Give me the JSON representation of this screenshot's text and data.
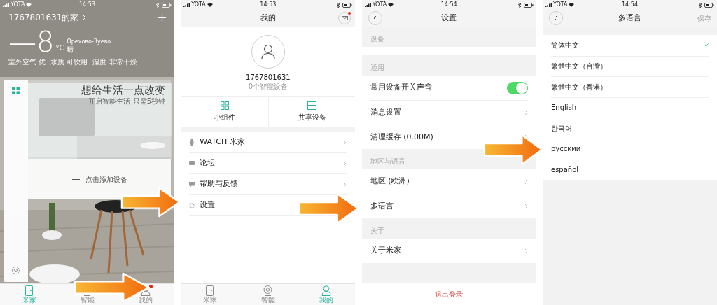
{
  "home_screen": {
    "status_bar": {
      "carrier": "YOTA",
      "time": "14:53"
    },
    "home_name": "1767801631的家",
    "temperature": "—8",
    "unit": "°C",
    "city": "Орехово-Зуево",
    "weather": "晴",
    "conditions": [
      "室外空气 优",
      "水质 可饮用",
      "湿度 非常干燥"
    ],
    "banner": {
      "title": "想给生活一点改变",
      "subtitle": "开启智能生活 只需5秒钟"
    },
    "add_device": "点击添加设备",
    "tabs": [
      {
        "label": "米家",
        "kind": "home",
        "selected": true,
        "badge": false
      },
      {
        "label": "智能",
        "kind": "smart",
        "selected": false,
        "badge": false
      },
      {
        "label": "我的",
        "kind": "profile",
        "selected": false,
        "badge": true
      }
    ]
  },
  "profile_screen": {
    "status_bar": {
      "carrier": "YOTA",
      "time": "14:53"
    },
    "title": "我的",
    "mail_badge": true,
    "user_id": "1767801631",
    "device_count": "0个智能设备",
    "shortcuts": [
      {
        "label": "小组件",
        "kind": "widgets"
      },
      {
        "label": "共享设备",
        "kind": "shared"
      }
    ],
    "menu": [
      {
        "label": "WATCH 米家",
        "kind": "watch"
      },
      {
        "label": "论坛",
        "kind": "forum"
      },
      {
        "label": "帮助与反馈",
        "kind": "help"
      },
      {
        "label": "设置",
        "kind": "settings"
      }
    ],
    "tabs": [
      {
        "label": "米家",
        "kind": "home",
        "selected": false,
        "badge": false
      },
      {
        "label": "智能",
        "kind": "smart",
        "selected": false,
        "badge": false
      },
      {
        "label": "我的",
        "kind": "profile",
        "selected": true,
        "badge": false
      }
    ]
  },
  "settings_screen": {
    "status_bar": {
      "carrier": "YOTA",
      "time": "14:54"
    },
    "title": "设置",
    "sections": [
      {
        "header": "设备"
      },
      {
        "header": "通用",
        "rows": [
          {
            "label": "常用设备开关声音",
            "kind": "toggle",
            "on": true
          },
          {
            "label": "消息设置",
            "kind": "link"
          },
          {
            "label": "清理缓存 (0.00M)",
            "kind": "link"
          }
        ]
      },
      {
        "header": "地区与语言",
        "rows": [
          {
            "label": "地区 (欧洲)",
            "kind": "link"
          },
          {
            "label": "多语言",
            "kind": "link"
          }
        ]
      },
      {
        "header": "关于",
        "rows": [
          {
            "label": "关于米家",
            "kind": "link"
          }
        ]
      }
    ],
    "logout": "退出登录"
  },
  "language_screen": {
    "status_bar": {
      "carrier": "YOTA",
      "time": "14:54"
    },
    "title": "多语言",
    "save": {
      "label": "保存",
      "disabled": true
    },
    "languages": [
      {
        "label": "简体中文",
        "selected": true
      },
      {
        "label": "繁體中文（台灣）",
        "selected": false
      },
      {
        "label": "繁體中文（香港）",
        "selected": false
      },
      {
        "label": "English",
        "selected": false
      },
      {
        "label": "한국어",
        "selected": false
      },
      {
        "label": "русский",
        "selected": false
      },
      {
        "label": "español",
        "selected": false
      }
    ]
  }
}
